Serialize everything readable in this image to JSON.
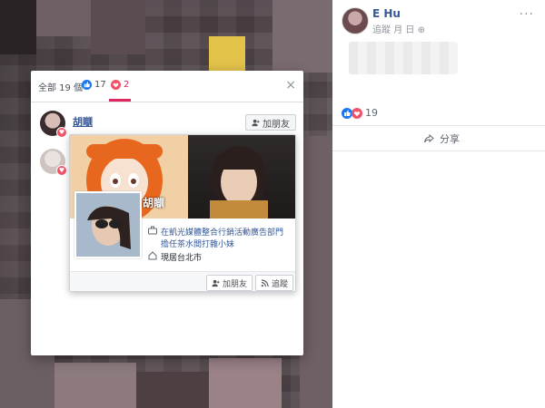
{
  "post": {
    "author": "E Hu",
    "meta_follow": "追蹤",
    "meta_date": "月 日",
    "reaction_count": "19",
    "share_label": "分享",
    "more": "···"
  },
  "reactions_dialog": {
    "tabs": [
      {
        "label": "全部 19 個"
      },
      {
        "icon": "like",
        "count": "17"
      },
      {
        "icon": "love",
        "count": "2"
      }
    ],
    "close": "×",
    "rows": [
      {
        "name": "胡瞓",
        "add_friend_label": "加朋友"
      }
    ],
    "tooltip": "胡瞓"
  },
  "hover_card": {
    "name": "胡瞓",
    "work": "在凱光媒體整合行銷活動廣告部門擔任茶水間打雜小妹",
    "lives_in": "現居台北市",
    "add_friend_label": "加朋友",
    "follow_label": "追蹤"
  },
  "colors": {
    "brand": "#365899",
    "love": "#f25268",
    "like": "#1877f2"
  }
}
